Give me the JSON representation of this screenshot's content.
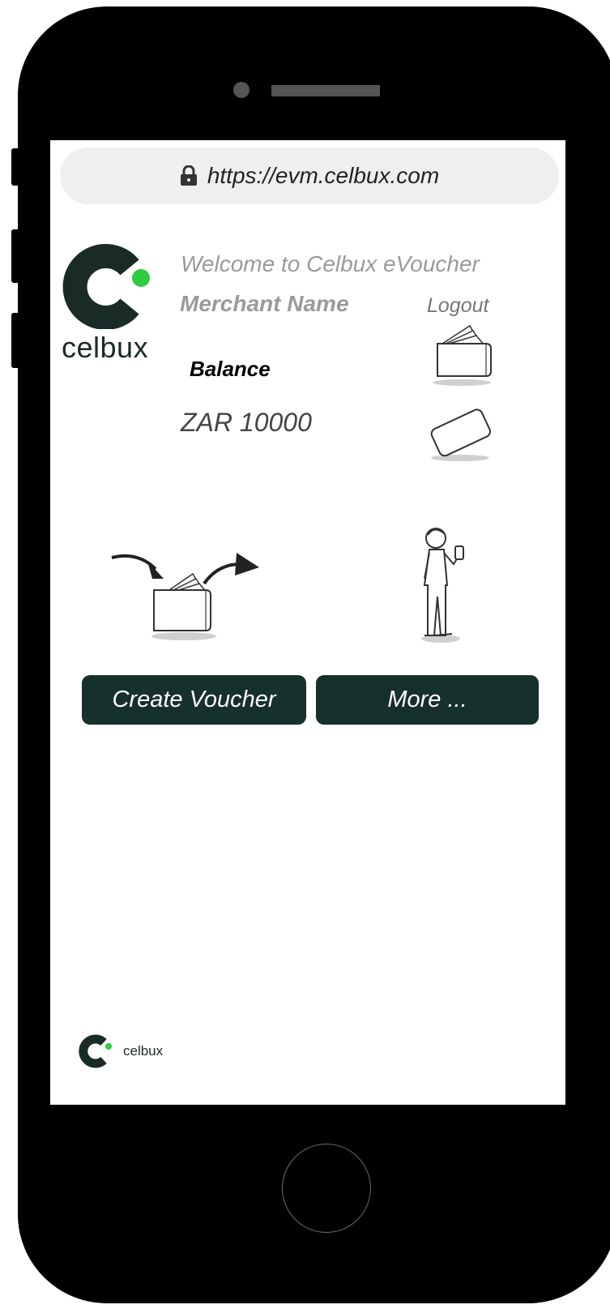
{
  "browser": {
    "url": "https://evm.celbux.com",
    "lock_icon": "lock-icon"
  },
  "brand": {
    "name": "celbux",
    "logo_color": "#1a2b27",
    "accent_color": "#2ecc40"
  },
  "header": {
    "welcome_text": "Welcome to Celbux eVoucher",
    "merchant_name": "Merchant Name",
    "logout_label": "Logout"
  },
  "balance": {
    "label": "Balance",
    "value": "ZAR 10000"
  },
  "icons": {
    "wallet": "wallet-icon",
    "card": "card-icon",
    "transfer": "voucher-transfer-icon",
    "person": "person-with-phone-icon"
  },
  "actions": {
    "create_voucher_label": "Create Voucher",
    "more_label": "More ...",
    "button_color": "#16302b"
  },
  "footer": {
    "brand_name": "celbux"
  }
}
